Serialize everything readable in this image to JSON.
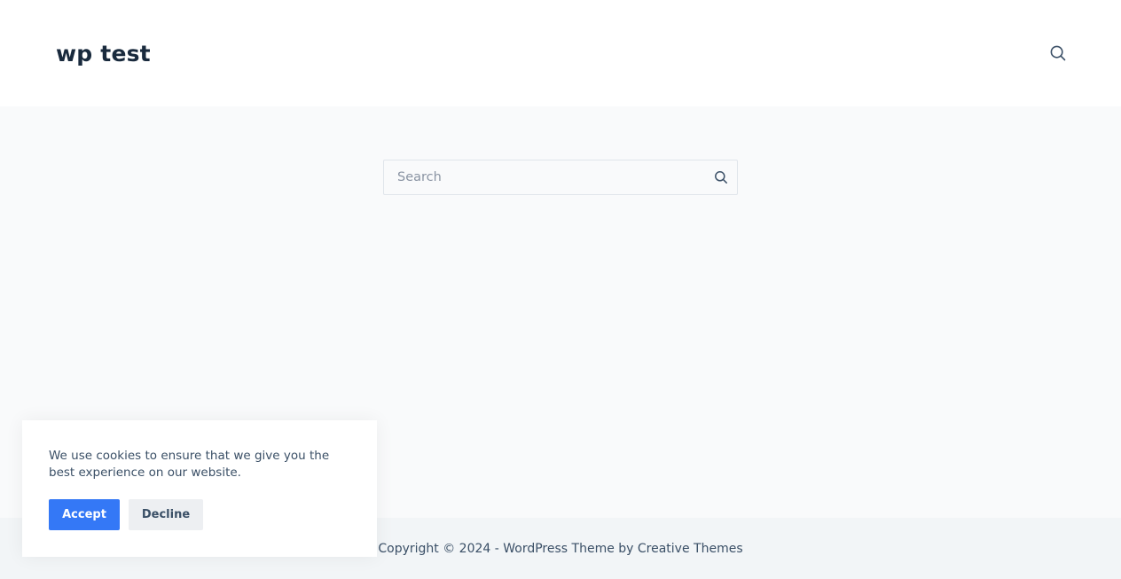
{
  "header": {
    "site_title": "wp test",
    "search_icon": "search-icon"
  },
  "main": {
    "search": {
      "placeholder": "Search",
      "value": "",
      "submit_icon": "search-icon"
    }
  },
  "footer": {
    "credit_text": "Copyright © 2024 - WordPress Theme by Creative Themes"
  },
  "cookie_banner": {
    "message": "We use cookies to ensure that we give you the best experience on our website.",
    "accept_label": "Accept",
    "decline_label": "Decline"
  },
  "colors": {
    "accent": "#3478f6",
    "title": "#192a3d",
    "text": "#3a4f66",
    "background": "#f9fafb",
    "footer_background": "#f2f5f7"
  }
}
